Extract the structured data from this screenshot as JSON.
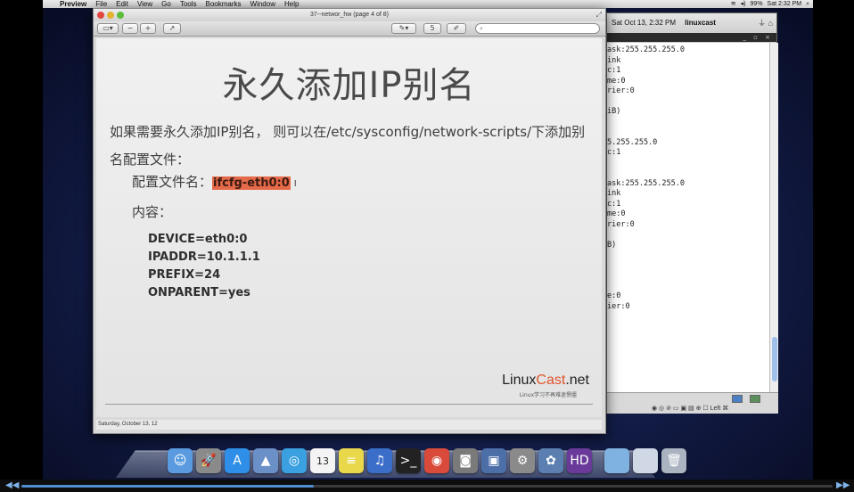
{
  "menubar": {
    "app": "Preview",
    "items": [
      "File",
      "Edit",
      "View",
      "Go",
      "Tools",
      "Bookmarks",
      "Window",
      "Help"
    ],
    "battery": "99%",
    "clock": "Sat 2:32 PM"
  },
  "preview": {
    "title": "37--networ_hw (page 4 of 8)",
    "search_placeholder": "",
    "page_value": "5",
    "footer_date": "Saturday, October 13, 12"
  },
  "slide": {
    "title": "永久添加IP别名",
    "paragraph": "如果需要永久添加IP别名， 则可以在/etc/sysconfig/network-scripts/下添加别名配置文件：",
    "config_label": "配置文件名：",
    "config_filename": "ifcfg-eth0:0",
    "content_label": "内容：",
    "code_lines": [
      "DEVICE=eth0:0",
      "IPADDR=10.1.1.1",
      "PREFIX=24",
      "ONPARENT=yes"
    ],
    "brand_prefix": "Linux",
    "brand_accent": "Cast",
    "brand_suffix": ".net",
    "brand_sub": "Linux学习不再难迷惘僵"
  },
  "vm": {
    "datetime": "Sat Oct 13,  2:32 PM",
    "hostname": "linuxcast",
    "status_right": "Left ⌘",
    "terminal_lines": [
      "ask:255.255.255.0",
      "ink",
      "c:1",
      "me:0",
      "rier:0",
      "",
      "iB)",
      "",
      "",
      "5.255.255.0",
      "c:1",
      "",
      "",
      "ask:255.255.255.0",
      "ink",
      "c:1",
      "me:0",
      "rier:0",
      "",
      "B)",
      "",
      "",
      "",
      "",
      "e:0",
      "ier:0"
    ]
  },
  "dock": {
    "icons": [
      "finder-icon",
      "launchpad-icon",
      "app-store-icon",
      "preview-icon",
      "safari-icon",
      "calendar-icon",
      "stickies-icon",
      "itunes-icon",
      "terminal-icon",
      "chrome-icon",
      "photo-booth-icon",
      "virtualbox-icon",
      "system-preferences-icon",
      "iphoto-icon",
      "hd-icon",
      "folder-icon",
      "documents-icon",
      "trash-icon"
    ],
    "calendar_day": "13"
  },
  "video": {
    "progress": 0.36
  }
}
